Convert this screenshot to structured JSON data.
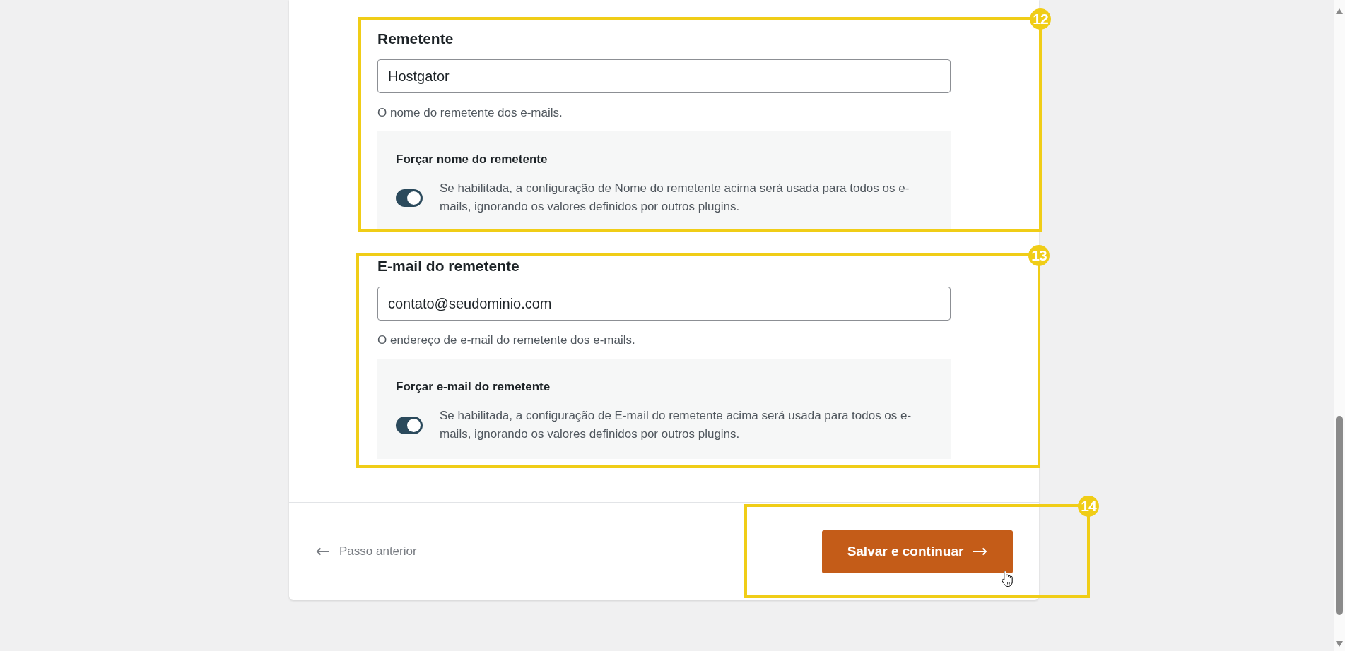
{
  "sections": [
    {
      "callout": "12",
      "heading": "Remetente",
      "field": {
        "value": "Hostgator"
      },
      "description": "O nome do remetente dos e-mails.",
      "option": {
        "label": "Forçar nome do remetente",
        "on": true,
        "description": "Se habilitada, a configuração de Nome do remetente acima será usada para todos os e-mails, ignorando os valores definidos por outros plugins."
      }
    },
    {
      "callout": "13",
      "heading": "E-mail do remetente",
      "field": {
        "value": "contato@seudominio.com"
      },
      "description": "O endereço de e-mail do remetente dos e-mails.",
      "option": {
        "label": "Forçar e-mail do remetente",
        "on": true,
        "description": "Se habilitada, a configuração de E-mail do remetente acima será usada para todos os e-mails, ignorando os valores definidos por outros plugins."
      }
    }
  ],
  "footer": {
    "back_link": "Passo anterior",
    "primary_button": {
      "label": "Salvar e continuar",
      "callout": "14"
    }
  }
}
